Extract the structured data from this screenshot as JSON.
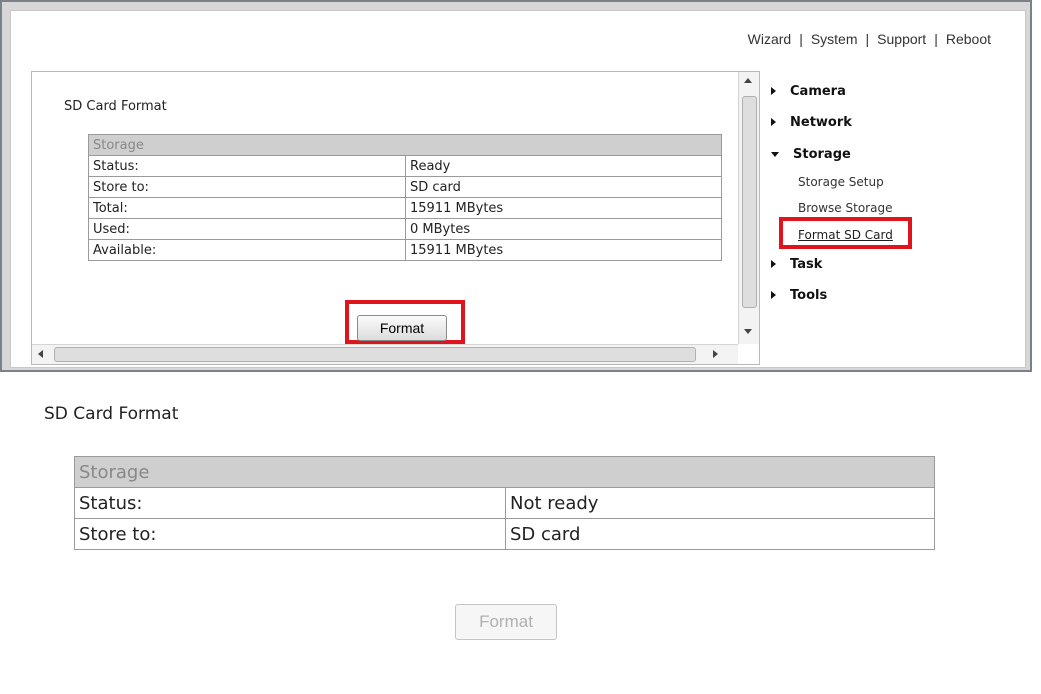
{
  "top_links": [
    "Wizard",
    "System",
    "Support",
    "Reboot"
  ],
  "panel_top": {
    "title": "SD Card Format",
    "table_header": "Storage",
    "rows": [
      {
        "label": "Status:",
        "value": "Ready"
      },
      {
        "label": "Store to:",
        "value": "SD card"
      },
      {
        "label": "Total:",
        "value": "15911 MBytes"
      },
      {
        "label": "Used:",
        "value": "0 MBytes"
      },
      {
        "label": "Available:",
        "value": "15911 MBytes"
      }
    ],
    "button": "Format"
  },
  "nav": {
    "camera": "Camera",
    "network": "Network",
    "storage": "Storage",
    "storage_items": [
      "Storage Setup",
      "Browse Storage",
      "Format SD Card"
    ],
    "task": "Task",
    "tools": "Tools"
  },
  "panel_bottom": {
    "title": "SD Card Format",
    "table_header": "Storage",
    "rows": [
      {
        "label": "Status:",
        "value": "Not ready"
      },
      {
        "label": "Store to:",
        "value": "SD card"
      }
    ],
    "button": "Format"
  },
  "colors": {
    "highlight": "#e0141c",
    "header_bg": "#cfcfcf"
  },
  "icons": [
    "triangle-right-icon",
    "triangle-down-icon",
    "scroll-arrow-icon"
  ]
}
